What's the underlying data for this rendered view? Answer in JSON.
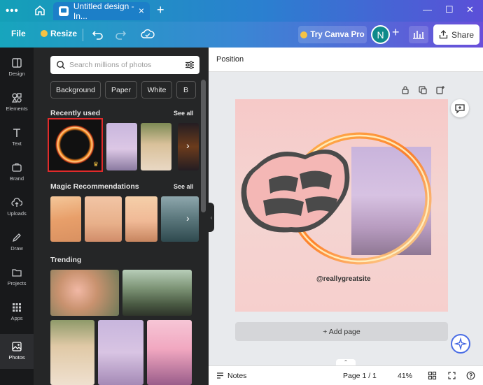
{
  "browser": {
    "tab_title": "Untitled design - In...",
    "new_tab": "+",
    "window_controls": [
      "—",
      "☐",
      "✕"
    ]
  },
  "toolbar": {
    "file": "File",
    "resize": "Resize",
    "try_pro": "Try Canva Pro",
    "avatar_letter": "N",
    "share": "Share"
  },
  "rail": {
    "items": [
      {
        "label": "Design",
        "icon": "design-icon"
      },
      {
        "label": "Elements",
        "icon": "elements-icon"
      },
      {
        "label": "Text",
        "icon": "text-icon"
      },
      {
        "label": "Brand",
        "icon": "brand-icon"
      },
      {
        "label": "Uploads",
        "icon": "uploads-icon"
      },
      {
        "label": "Draw",
        "icon": "draw-icon"
      },
      {
        "label": "Projects",
        "icon": "projects-icon"
      },
      {
        "label": "Apps",
        "icon": "apps-icon"
      },
      {
        "label": "Photos",
        "icon": "photos-icon",
        "active": true
      }
    ]
  },
  "panel": {
    "search_placeholder": "Search millions of photos",
    "chips": [
      "Background",
      "Paper",
      "White",
      "B"
    ],
    "recently_used": "Recently used",
    "magic_recommendations": "Magic Recommendations",
    "trending": "Trending",
    "see_all": "See all"
  },
  "editor": {
    "position": "Position",
    "canvas_handle": "@reallygreatsite",
    "add_page": "+ Add page",
    "notes": "Notes",
    "page_indicator": "Page 1 / 1",
    "zoom": "41%"
  },
  "colors": {
    "highlight_red": "#e02b2b",
    "share_love_dark": "#4a4a4a",
    "canvas_pink": "#f6c9c8"
  }
}
